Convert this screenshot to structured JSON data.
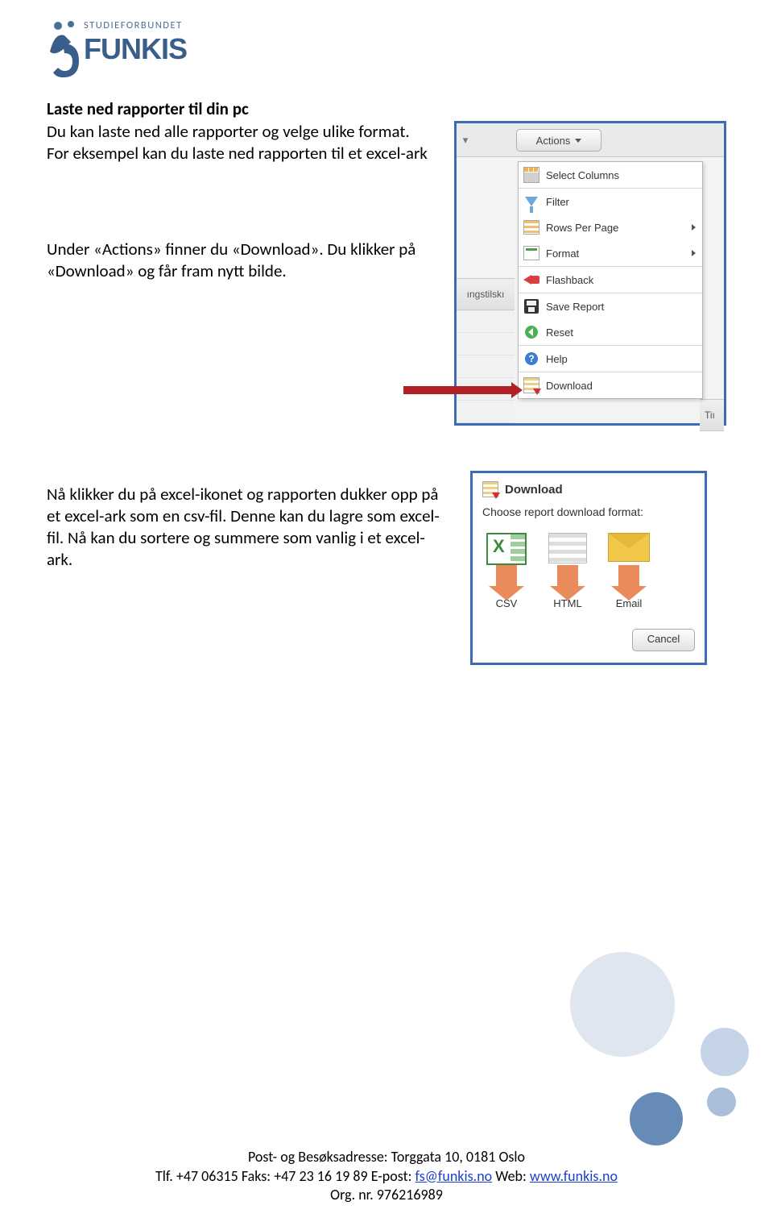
{
  "logo": {
    "tagline": "STUDIEFORBUNDET",
    "name": "FUNKIS"
  },
  "heading": "Laste ned rapporter til din pc",
  "para1": "Du kan laste ned alle rapporter og velge ulike format. For eksempel kan du laste ned rapporten til et excel-ark",
  "para2": "Under «Actions» finner du «Download». Du klikker på «Download» og får fram nytt bilde.",
  "para3": "Nå klikker du på excel-ikonet og rapporten dukker opp på et excel-ark som en csv-fil. Denne kan du lagre som excel-fil. Nå kan du sortere og summere som vanlig i et excel-ark.",
  "shot1": {
    "actions_label": "Actions",
    "left_tab": "ıngstilskı",
    "right_tab": "Tiı",
    "menu": {
      "select_columns": "Select Columns",
      "filter": "Filter",
      "rows_per_page": "Rows Per Page",
      "format": "Format",
      "flashback": "Flashback",
      "save_report": "Save Report",
      "reset": "Reset",
      "help": "Help",
      "download": "Download"
    }
  },
  "shot2": {
    "title": "Download",
    "subtitle": "Choose report download format:",
    "fmt_csv": "CSV",
    "fmt_html": "HTML",
    "fmt_email": "Email",
    "cancel": "Cancel"
  },
  "footer": {
    "line1": "Post- og  Besøksadresse: Torggata 10, 0181 Oslo",
    "tlf_label": "Tlf. ",
    "tlf": "+47 06315",
    "faks_label": "     Faks: ",
    "faks": "+47 23 16 19 89",
    "epost_label": "   E-post: ",
    "epost_link": "fs@funkis.no",
    "web_label": "     Web: ",
    "web_link": "www.funkis.no",
    "line3": "Org. nr. 976216989"
  }
}
